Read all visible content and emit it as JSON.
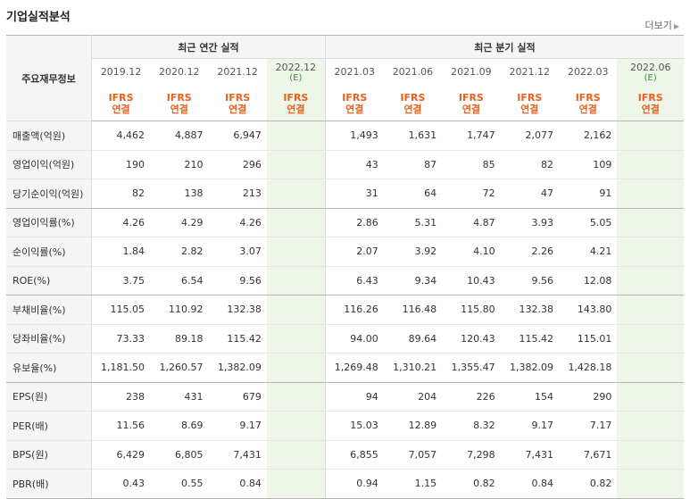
{
  "title": "기업실적분석",
  "more_label": "더보기",
  "header": {
    "row_label": "주요재무정보",
    "annual_group": "최근 연간 실적",
    "quarter_group": "최근 분기 실적",
    "annual_periods": [
      {
        "label": "2019.12",
        "est": ""
      },
      {
        "label": "2020.12",
        "est": ""
      },
      {
        "label": "2021.12",
        "est": ""
      },
      {
        "label": "2022.12",
        "est": "(E)"
      }
    ],
    "quarter_periods": [
      {
        "label": "2021.03",
        "est": ""
      },
      {
        "label": "2021.06",
        "est": ""
      },
      {
        "label": "2021.09",
        "est": ""
      },
      {
        "label": "2021.12",
        "est": ""
      },
      {
        "label": "2022.03",
        "est": ""
      },
      {
        "label": "2022.06",
        "est": "(E)"
      }
    ],
    "basis_line1": "IFRS",
    "basis_line2": "연결"
  },
  "rows": [
    {
      "label": "매출액(억원)",
      "annual": [
        "4,462",
        "4,887",
        "6,947",
        ""
      ],
      "quarter": [
        "1,493",
        "1,631",
        "1,747",
        "2,077",
        "2,162",
        ""
      ]
    },
    {
      "label": "영업이익(억원)",
      "annual": [
        "190",
        "210",
        "296",
        ""
      ],
      "quarter": [
        "43",
        "87",
        "85",
        "82",
        "109",
        ""
      ]
    },
    {
      "label": "당기순이익(억원)",
      "annual": [
        "82",
        "138",
        "213",
        ""
      ],
      "quarter": [
        "31",
        "64",
        "72",
        "47",
        "91",
        ""
      ]
    },
    {
      "label": "영업이익률(%)",
      "annual": [
        "4.26",
        "4.29",
        "4.26",
        ""
      ],
      "quarter": [
        "2.86",
        "5.31",
        "4.87",
        "3.93",
        "5.05",
        ""
      ]
    },
    {
      "label": "순이익률(%)",
      "annual": [
        "1.84",
        "2.82",
        "3.07",
        ""
      ],
      "quarter": [
        "2.07",
        "3.92",
        "4.10",
        "2.26",
        "4.21",
        ""
      ]
    },
    {
      "label": "ROE(%)",
      "annual": [
        "3.75",
        "6.54",
        "9.56",
        ""
      ],
      "quarter": [
        "6.43",
        "9.34",
        "10.43",
        "9.56",
        "12.08",
        ""
      ]
    },
    {
      "label": "부채비율(%)",
      "annual": [
        "115.05",
        "110.92",
        "132.38",
        ""
      ],
      "quarter": [
        "116.26",
        "116.48",
        "115.80",
        "132.38",
        "143.80",
        ""
      ]
    },
    {
      "label": "당좌비율(%)",
      "annual": [
        "73.33",
        "89.18",
        "115.42",
        ""
      ],
      "quarter": [
        "94.00",
        "89.64",
        "120.43",
        "115.42",
        "115.01",
        ""
      ]
    },
    {
      "label": "유보율(%)",
      "annual": [
        "1,181.50",
        "1,260.57",
        "1,382.09",
        ""
      ],
      "quarter": [
        "1,269.48",
        "1,310.21",
        "1,355.47",
        "1,382.09",
        "1,428.18",
        ""
      ]
    },
    {
      "label": "EPS(원)",
      "annual": [
        "238",
        "431",
        "679",
        ""
      ],
      "quarter": [
        "94",
        "204",
        "226",
        "154",
        "290",
        ""
      ]
    },
    {
      "label": "PER(배)",
      "annual": [
        "11.56",
        "8.69",
        "9.17",
        ""
      ],
      "quarter": [
        "15.03",
        "12.89",
        "8.32",
        "9.17",
        "7.17",
        ""
      ]
    },
    {
      "label": "BPS(원)",
      "annual": [
        "6,429",
        "6,805",
        "7,431",
        ""
      ],
      "quarter": [
        "6,855",
        "7,057",
        "7,298",
        "7,431",
        "7,671",
        ""
      ]
    },
    {
      "label": "PBR(배)",
      "annual": [
        "0.43",
        "0.55",
        "0.84",
        ""
      ],
      "quarter": [
        "0.94",
        "1.15",
        "0.82",
        "0.84",
        "0.82",
        ""
      ]
    }
  ],
  "group_breaks_after": [
    2,
    5,
    8
  ],
  "colors": {
    "basis": "#e8601c",
    "estimate_bg": "#eef6ea",
    "estimate_text": "#3a8c3a",
    "label_bg": "#f5f5f5"
  }
}
